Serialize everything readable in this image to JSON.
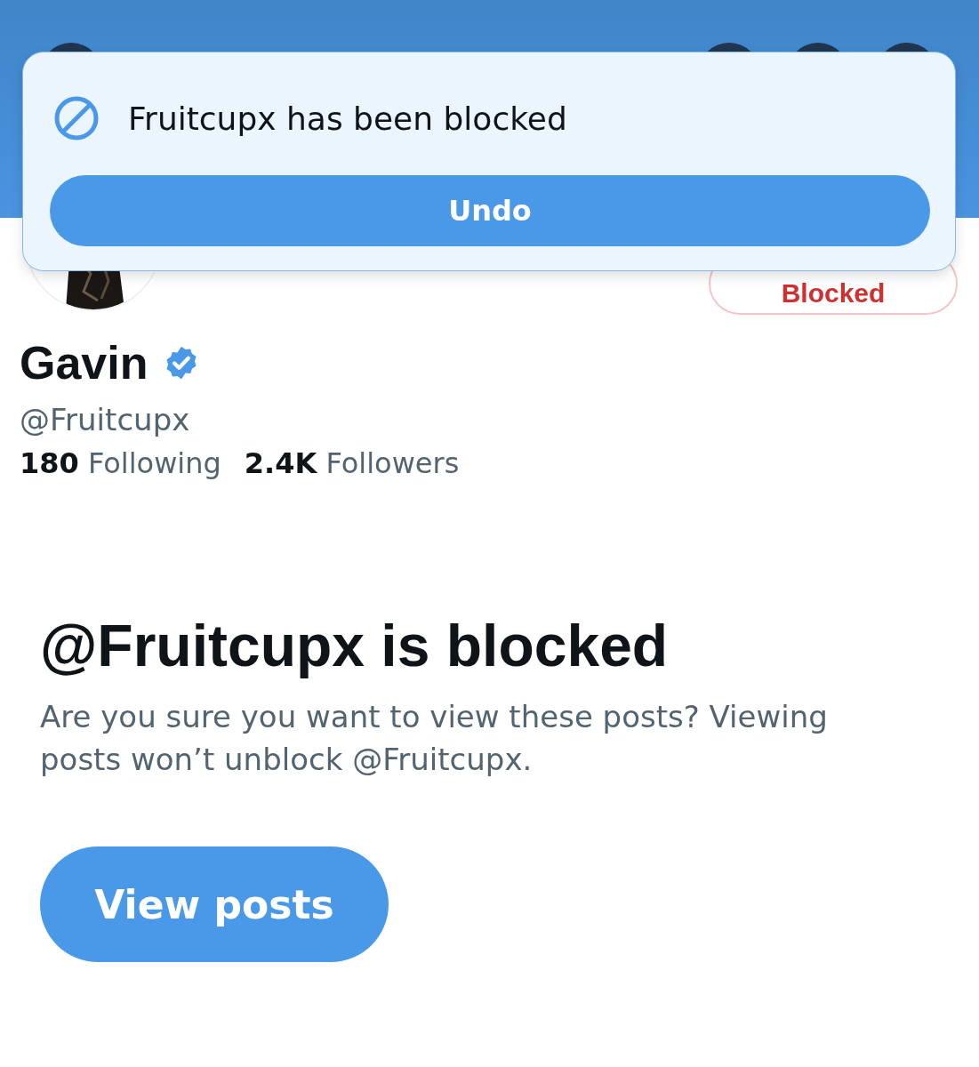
{
  "toast": {
    "message": "Fruitcupx has been blocked",
    "action": "Undo"
  },
  "profile": {
    "name": "Gavin",
    "verified": true,
    "handle": "@Fruitcupx",
    "action_button": "Blocked",
    "stats": [
      "**180** Following",
      "**2.4K** Followers"
    ]
  },
  "blocked_notice": {
    "title": "@Fruitcupx is blocked",
    "message": "Are you sure you want to view these posts? Viewing posts won’t unblock @Fruitcupx.",
    "button": "View posts"
  }
}
